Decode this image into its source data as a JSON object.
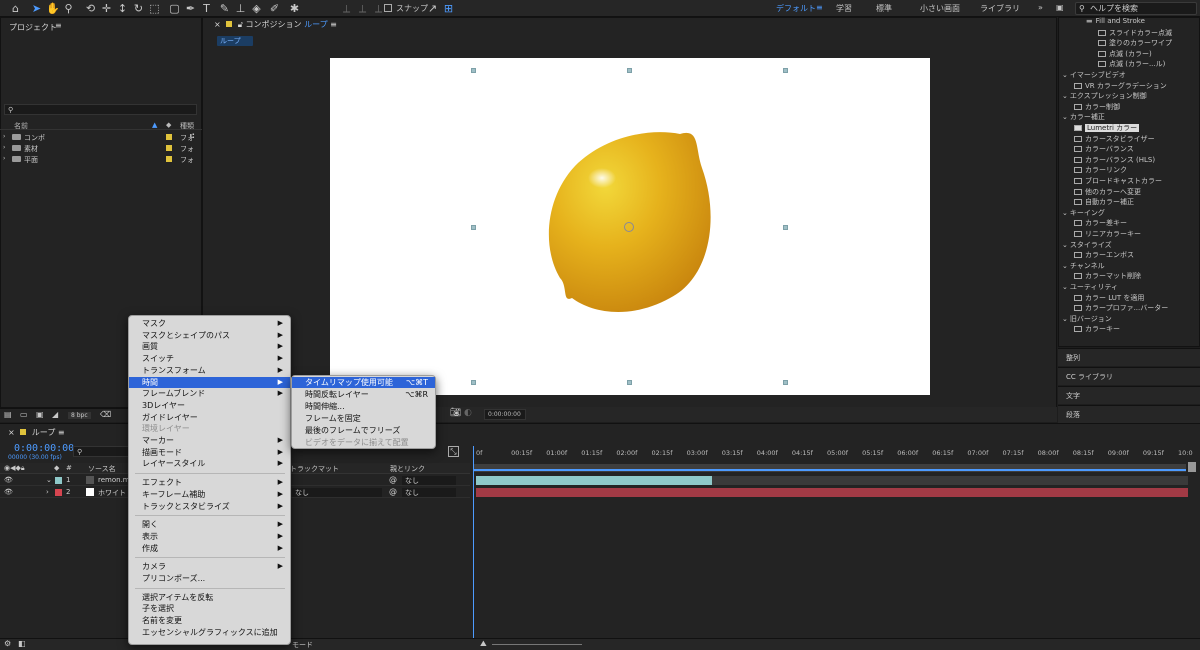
{
  "workspaces": {
    "default": "デフォルト",
    "learn": "学習",
    "standard": "標準",
    "small": "小さい画面",
    "library": "ライブラリ"
  },
  "toolbar": {
    "snap_label": "スナップ"
  },
  "help_search": {
    "placeholder": "ヘルプを検索"
  },
  "project": {
    "title": "プロジェクト",
    "col_name": "名前",
    "col_type": "種類",
    "items": [
      {
        "name": "コンポ",
        "type": "フォ"
      },
      {
        "name": "素材",
        "type": "フォ"
      },
      {
        "name": "平面",
        "type": "フォ"
      }
    ],
    "bpc": "8 bpc"
  },
  "composition": {
    "tab_prefix": "コンポジション",
    "tab_name": "ループ",
    "breadcrumb": "ループ",
    "timecode": "0:00:00:00"
  },
  "effects": {
    "items": [
      {
        "label": "Fill and Stroke",
        "kind": "folder",
        "indent": 2
      },
      {
        "label": "スライドカラー点滅",
        "kind": "fx",
        "indent": 3
      },
      {
        "label": "塗りのカラーワイプ",
        "kind": "fx",
        "indent": 3
      },
      {
        "label": "点滅 (カラー)",
        "kind": "fx",
        "indent": 3
      },
      {
        "label": "点滅 (カラー...ル)",
        "kind": "fx",
        "indent": 3
      },
      {
        "label": "イマーシブビデオ",
        "kind": "cat",
        "indent": 0
      },
      {
        "label": "VR カラーグラデーション",
        "kind": "fx",
        "indent": 1
      },
      {
        "label": "エクスプレッション制御",
        "kind": "cat",
        "indent": 0
      },
      {
        "label": "カラー制御",
        "kind": "fx",
        "indent": 1
      },
      {
        "label": "カラー補正",
        "kind": "cat",
        "indent": 0
      },
      {
        "label": "Lumetri カラー",
        "kind": "fx-sel",
        "indent": 1
      },
      {
        "label": "カラースタビライザー",
        "kind": "fx",
        "indent": 1
      },
      {
        "label": "カラーバランス",
        "kind": "fx",
        "indent": 1
      },
      {
        "label": "カラーバランス (HLS)",
        "kind": "fx",
        "indent": 1
      },
      {
        "label": "カラーリンク",
        "kind": "fx",
        "indent": 1
      },
      {
        "label": "ブロードキャストカラー",
        "kind": "fx",
        "indent": 1
      },
      {
        "label": "他のカラーへ変更",
        "kind": "fx",
        "indent": 1
      },
      {
        "label": "自動カラー補正",
        "kind": "fx",
        "indent": 1
      },
      {
        "label": "キーイング",
        "kind": "cat",
        "indent": 0
      },
      {
        "label": "カラー差キー",
        "kind": "fx",
        "indent": 1
      },
      {
        "label": "リニアカラーキー",
        "kind": "fx",
        "indent": 1
      },
      {
        "label": "スタイライズ",
        "kind": "cat",
        "indent": 0
      },
      {
        "label": "カラーエンボス",
        "kind": "fx",
        "indent": 1
      },
      {
        "label": "チャンネル",
        "kind": "cat",
        "indent": 0
      },
      {
        "label": "カラーマット削除",
        "kind": "fx",
        "indent": 1
      },
      {
        "label": "ユーティリティ",
        "kind": "cat",
        "indent": 0
      },
      {
        "label": "カラー LUT を適用",
        "kind": "fx",
        "indent": 1
      },
      {
        "label": "カラープロファ...バーター",
        "kind": "fx",
        "indent": 1
      },
      {
        "label": "旧バージョン",
        "kind": "cat",
        "indent": 0
      },
      {
        "label": "カラーキー",
        "kind": "fx",
        "indent": 1
      }
    ]
  },
  "side_panels": {
    "align": "整列",
    "cc_library": "CC ライブラリ",
    "text": "文字",
    "paragraph": "段落"
  },
  "timeline": {
    "tab": "ループ",
    "timecode": "0:00:00:00",
    "fps": "00000 (30.00 fps)",
    "col_source": "ソース名",
    "col_trackmatte": "トラックマット",
    "col_parent": "親とリンク",
    "layers": [
      {
        "num": "1",
        "name": "remon.m",
        "matte": "",
        "parent": "なし",
        "color": "#8ec8c8"
      },
      {
        "num": "2",
        "name": "ホワイト",
        "matte": "なし",
        "parent": "なし",
        "color": "#d64550"
      }
    ],
    "ticks": [
      "0f",
      "00:15f",
      "01:00f",
      "01:15f",
      "02:00f",
      "02:15f",
      "03:00f",
      "03:15f",
      "04:00f",
      "04:15f",
      "05:00f",
      "05:15f",
      "06:00f",
      "06:15f",
      "07:00f",
      "07:15f",
      "08:00f",
      "08:15f",
      "09:00f",
      "09:15f",
      "10:0"
    ],
    "mode_label": "モード"
  },
  "context_menu": {
    "items": [
      {
        "label": "マスク",
        "sub": true
      },
      {
        "label": "マスクとシェイプのパス",
        "sub": true
      },
      {
        "label": "画質",
        "sub": true
      },
      {
        "label": "スイッチ",
        "sub": true
      },
      {
        "label": "トランスフォーム",
        "sub": true
      },
      {
        "label": "時間",
        "sub": true,
        "highlight": true
      },
      {
        "label": "フレームブレンド",
        "sub": true
      },
      {
        "label": "3Dレイヤー",
        "sub": false
      },
      {
        "label": "ガイドレイヤー",
        "sub": false
      },
      {
        "label": "環境レイヤー",
        "sub": false,
        "disabled": true
      },
      {
        "label": "マーカー",
        "sub": true
      },
      {
        "label": "描画モード",
        "sub": true
      },
      {
        "label": "レイヤースタイル",
        "sub": true
      },
      {
        "sep": true
      },
      {
        "label": "エフェクト",
        "sub": true
      },
      {
        "label": "キーフレーム補助",
        "sub": true
      },
      {
        "label": "トラックとスタビライズ",
        "sub": true
      },
      {
        "sep": true
      },
      {
        "label": "開く",
        "sub": true
      },
      {
        "label": "表示",
        "sub": true
      },
      {
        "label": "作成",
        "sub": true
      },
      {
        "sep": true
      },
      {
        "label": "カメラ",
        "sub": true
      },
      {
        "label": "プリコンポーズ...",
        "sub": false
      },
      {
        "sep": true
      },
      {
        "label": "選択アイテムを反転",
        "sub": false
      },
      {
        "label": "子を選択",
        "sub": false
      },
      {
        "label": "名前を変更",
        "sub": false
      },
      {
        "label": "エッセンシャルグラフィックスに追加",
        "sub": false
      }
    ]
  },
  "submenu": {
    "items": [
      {
        "label": "タイムリマップ使用可能",
        "shortcut": "⌥⌘T",
        "highlight": true
      },
      {
        "label": "時間反転レイヤー",
        "shortcut": "⌥⌘R"
      },
      {
        "label": "時間伸縮...",
        "shortcut": ""
      },
      {
        "label": "フレームを固定",
        "shortcut": ""
      },
      {
        "label": "最後のフレームでフリーズ",
        "shortcut": ""
      },
      {
        "label": "ビデオをデータに揃えて配置",
        "shortcut": "",
        "disabled": true
      }
    ]
  }
}
